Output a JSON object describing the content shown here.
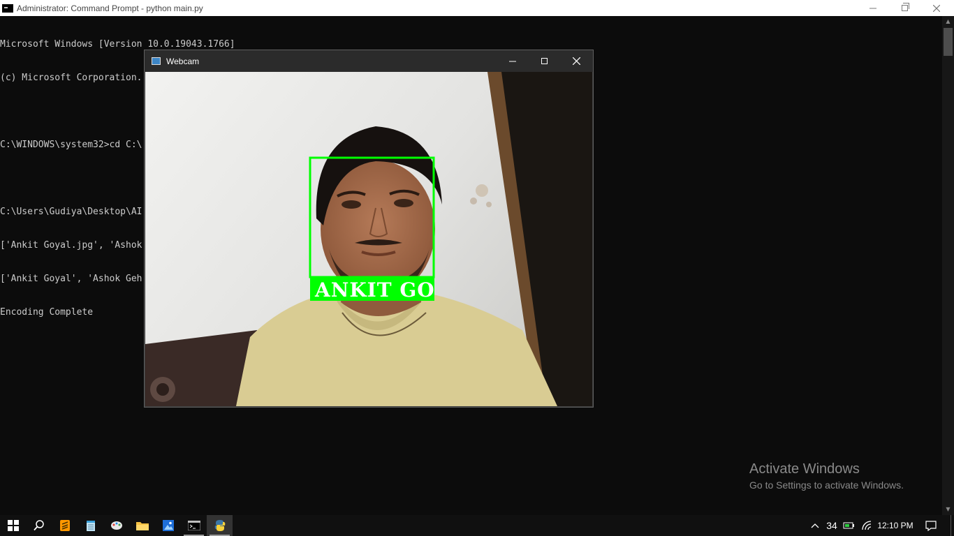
{
  "cmd": {
    "title": "Administrator: Command Prompt - python  main.py",
    "lines": [
      "Microsoft Windows [Version 10.0.19043.1766]",
      "(c) Microsoft Corporation. All rights reserved.",
      "",
      "C:\\WINDOWS\\system32>cd C:\\",
      "",
      "C:\\Users\\Gudiya\\Desktop\\AI",
      "['Ankit Goyal.jpg', 'Ashok",
      "['Ankit Goyal', 'Ashok Geh",
      "Encoding Complete"
    ]
  },
  "webcam": {
    "title": "Webcam",
    "detection_label": "ANKIT GOYAL",
    "box_color": "#00ff00"
  },
  "watermark": {
    "title": "Activate Windows",
    "subtitle": "Go to Settings to activate Windows."
  },
  "taskbar": {
    "apps": [
      "windows-start-icon",
      "search-icon",
      "sublime-text-icon",
      "notepad-icon",
      "paint-icon",
      "file-explorer-icon",
      "photos-icon",
      "command-prompt-icon",
      "python-icon"
    ],
    "temperature": "34",
    "clock": "12:10 PM"
  }
}
